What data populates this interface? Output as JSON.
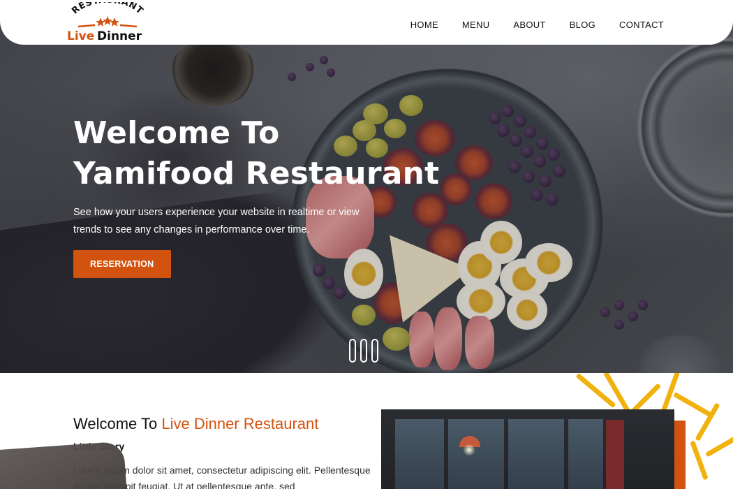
{
  "logo": {
    "top_text": "RESTAURANT",
    "name_part1": "Live",
    "name_part2": "Dinner"
  },
  "nav": {
    "items": [
      "HOME",
      "MENU",
      "ABOUT",
      "BLOG",
      "CONTACT"
    ]
  },
  "hero": {
    "title_line1": "Welcome To",
    "title_line2": "Yamifood Restaurant",
    "subtitle": "See how your users experience your website in realtime or view trends to see any changes in performance over time.",
    "button_label": "RESERVATION",
    "slides": 3
  },
  "about": {
    "title_prefix": "Welcome To ",
    "title_accent": "Live Dinner Restaurant",
    "subtitle": "Little Story",
    "paragraph": "Lorem ipsum dolor sit amet, consectetur adipiscing elit. Pellentesque auctor suscipit feugiat. Ut at pellentesque ante, sed"
  },
  "colors": {
    "accent": "#d2520f",
    "text": "#111111",
    "white": "#ffffff"
  }
}
